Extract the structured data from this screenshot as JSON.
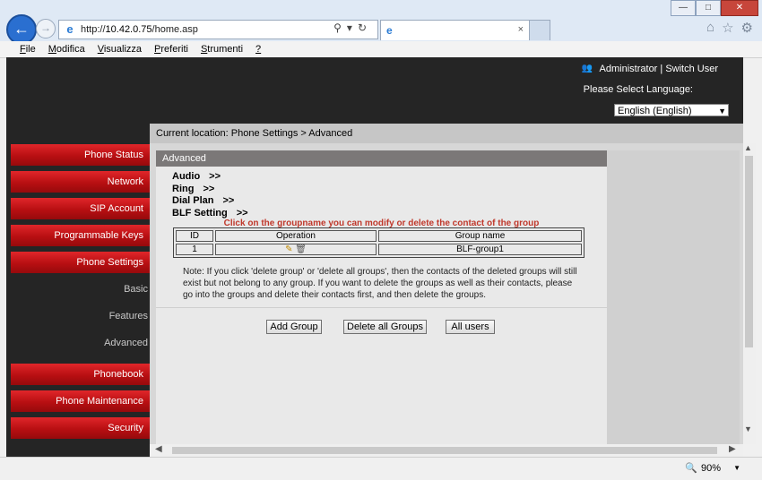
{
  "browser": {
    "url_prefix": "http://",
    "url_host": "10.42.0.75",
    "url_path": "/home.asp",
    "tab_close": "×",
    "menu": [
      "File",
      "Modifica",
      "Visualizza",
      "Preferiti",
      "Strumenti",
      "?"
    ],
    "zoom": "90%"
  },
  "header": {
    "user_text": "Administrator | Switch User",
    "language_label": "Please Select Language:",
    "language_value": "English (English)"
  },
  "breadcrumb": "Current location: Phone Settings > Advanced",
  "sidebar": {
    "items": [
      "Phone Status",
      "Network",
      "SIP Account",
      "Programmable Keys",
      "Phone Settings"
    ],
    "subitems": [
      "Basic",
      "Features",
      "Advanced"
    ],
    "items_bottom": [
      "Phonebook",
      "Phone Maintenance",
      "Security"
    ]
  },
  "panel": {
    "title": "Advanced",
    "links": [
      "Audio",
      "Ring",
      "Dial Plan",
      "BLF Setting"
    ],
    "link_suffix": ">>",
    "hint": "Click on the groupname you can modify or delete the contact of the group",
    "table": {
      "headers": [
        "ID",
        "Operation",
        "Group name"
      ],
      "rows": [
        {
          "id": "1",
          "group": "BLF-group1"
        }
      ]
    },
    "note": "Note: If you click 'delete group' or 'delete all groups', then the contacts of the deleted groups will still exist but not belong to any group. If you want to delete the groups as well as their contacts, please go into the groups and delete their contacts first, and then delete the groups.",
    "buttons": [
      "Add Group",
      "Delete all Groups",
      "All users"
    ]
  },
  "icons": {
    "back": "back-arrow-icon",
    "forward": "forward-arrow-icon",
    "ie": "internet-explorer-icon",
    "home": "home-icon",
    "favorites": "star-icon",
    "settings": "gear-icon",
    "edit": "pencil-icon",
    "delete": "trash-icon",
    "zoom": "magnifier-icon"
  },
  "colors": {
    "sidebar_button": "#b80f12",
    "header_bg": "#252525",
    "hint_text": "#c0382b",
    "panel_header": "#7b7878"
  }
}
